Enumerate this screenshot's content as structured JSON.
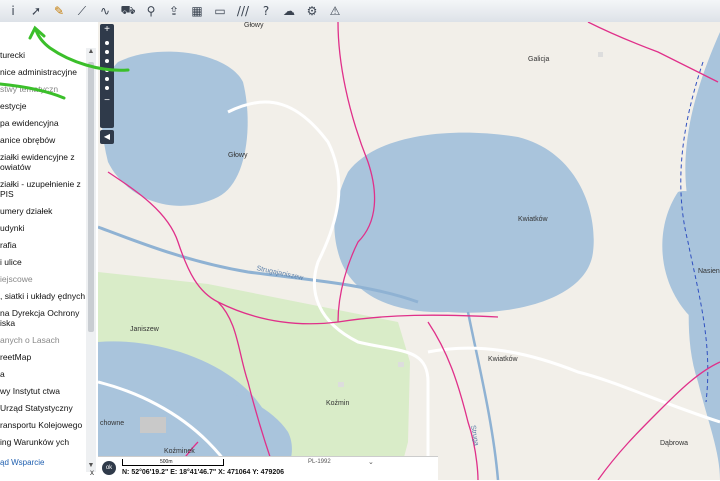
{
  "toolbar": {
    "tools": [
      {
        "name": "info-tool",
        "glyph": "i"
      },
      {
        "name": "select-arrow",
        "glyph": "➚"
      },
      {
        "name": "pencil-tool",
        "glyph": "✎"
      },
      {
        "name": "measure-line",
        "glyph": "⟋"
      },
      {
        "name": "measure-area",
        "glyph": "∿"
      },
      {
        "name": "vehicle-tool",
        "glyph": "⛟"
      },
      {
        "name": "location-pin",
        "glyph": "⚲"
      },
      {
        "name": "export-tool",
        "glyph": "⇪"
      },
      {
        "name": "layout-tool",
        "glyph": "▦"
      },
      {
        "name": "comment-tool",
        "glyph": "▭"
      },
      {
        "name": "hatch-tool",
        "glyph": "///"
      },
      {
        "name": "help-tool",
        "glyph": "?"
      },
      {
        "name": "cloud-upload",
        "glyph": "☁"
      },
      {
        "name": "settings-tool",
        "glyph": "⚙"
      },
      {
        "name": "warning-tool",
        "glyph": "⚠"
      }
    ]
  },
  "sidebar": {
    "layers": [
      {
        "label": "turecki",
        "group": false
      },
      {
        "label": "nice administracyjne",
        "group": false
      },
      {
        "label": "stwy tematyczn",
        "group": true
      },
      {
        "label": "estycje",
        "group": false
      },
      {
        "label": "pa ewidencyjna",
        "group": false
      },
      {
        "label": "anice obrębów",
        "group": false
      },
      {
        "label": "ziałki ewidencyjne z owiatów",
        "group": false
      },
      {
        "label": "ziałki - uzupełnienie z PIS",
        "group": false
      },
      {
        "label": "umery działek",
        "group": false
      },
      {
        "label": "udynki",
        "group": false
      },
      {
        "label": "rafia",
        "group": false
      },
      {
        "label": "i ulice",
        "group": false
      },
      {
        "label": "iejscowe",
        "group": true
      },
      {
        "label": ", siatki i układy ędnych",
        "group": false
      },
      {
        "label": "na Dyrekcja Ochrony iska",
        "group": false
      },
      {
        "label": "anych o Lasach",
        "group": true
      },
      {
        "label": "reetMap",
        "group": false
      },
      {
        "label": "a",
        "group": false
      },
      {
        "label": "wy Instytut ctwa",
        "group": false
      },
      {
        "label": " Urząd Statystyczny",
        "group": false
      },
      {
        "label": "ransportu Kolejowego",
        "group": false
      },
      {
        "label": "ing Warunków ych",
        "group": false
      }
    ],
    "footer_links": "ąd  Wsparcie",
    "close": "x"
  },
  "map": {
    "labels": [
      {
        "text": "Głowy",
        "name": "label-glowy-top"
      },
      {
        "text": "Galicja",
        "name": "label-galicja"
      },
      {
        "text": "Głowy",
        "name": "label-glowy-lake"
      },
      {
        "text": "Kwiatków",
        "name": "label-kwiatkow-lake"
      },
      {
        "text": "Nasien",
        "name": "label-nasien"
      },
      {
        "text": "Strugajaniszew",
        "name": "label-stream"
      },
      {
        "text": "Janiszew",
        "name": "label-janiszew"
      },
      {
        "text": "Kwiatków",
        "name": "label-kwiatkow-village"
      },
      {
        "text": "Koźmin",
        "name": "label-kozmin"
      },
      {
        "text": "chowne",
        "name": "label-chowne"
      },
      {
        "text": "Koźminek",
        "name": "label-kozminek"
      },
      {
        "text": "Dąbrowa",
        "name": "label-dabrowa"
      },
      {
        "text": "Struga",
        "name": "label-struga-south"
      }
    ],
    "zoom_plus": "+",
    "zoom_minus": "−",
    "collapse": "◀"
  },
  "status": {
    "ok": "ok",
    "scale_label": "500m",
    "coords": "N: 52°06'19.2\" E: 18°41'46.7\"  X: 471064   Y: 479206",
    "crs": "PL-1992",
    "crs_chevron": "⌄"
  },
  "colors": {
    "water": "#a9c4dc",
    "land": "#f2efe9",
    "forest": "#d9ecc8",
    "boundary": "#e0308a",
    "road": "#ffffff",
    "river": "#8fb2d3"
  }
}
